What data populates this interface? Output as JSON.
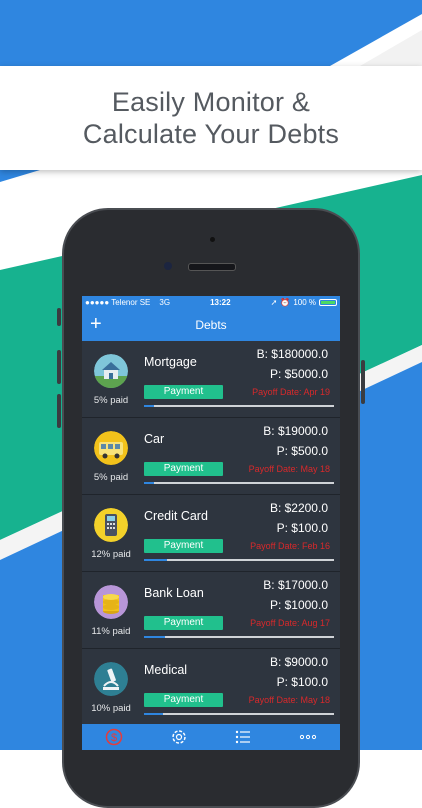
{
  "headline": {
    "line1": "Easily Monitor &",
    "line2": "Calculate Your Debts"
  },
  "status_bar": {
    "carrier": "●●●●● Telenor SE",
    "network": "3G",
    "time": "13:22",
    "battery": "100 %"
  },
  "nav": {
    "title": "Debts",
    "add_icon": "+"
  },
  "debts": [
    {
      "name": "Mortgage",
      "paid": "5% paid",
      "progress": 0.05,
      "balance": "B: $180000.0",
      "payment": "P: $5000.0",
      "payment_button": "Payment",
      "payoff": "Payoff Date: Apr 19",
      "icon": "house-icon"
    },
    {
      "name": "Car",
      "paid": "5% paid",
      "progress": 0.05,
      "balance": "B: $19000.0",
      "payment": "P: $500.0",
      "payment_button": "Payment",
      "payoff": "Payoff Date: May 18",
      "icon": "bus-icon"
    },
    {
      "name": "Credit Card",
      "paid": "12% paid",
      "progress": 0.12,
      "balance": "B: $2200.0",
      "payment": "P: $100.0",
      "payment_button": "Payment",
      "payoff": "Payoff Date: Feb 16",
      "icon": "card-terminal-icon"
    },
    {
      "name": "Bank Loan",
      "paid": "11% paid",
      "progress": 0.11,
      "balance": "B: $17000.0",
      "payment": "P: $1000.0",
      "payment_button": "Payment",
      "payoff": "Payoff Date: Aug 17",
      "icon": "coins-icon"
    },
    {
      "name": "Medical",
      "paid": "10% paid",
      "progress": 0.1,
      "balance": "B: $9000.0",
      "payment": "P: $100.0",
      "payment_button": "Payment",
      "payoff": "Payoff Date: May 18",
      "icon": "microscope-icon"
    }
  ],
  "tabs": [
    "dollar-icon",
    "gear-icon",
    "list-icon",
    "more-icon"
  ],
  "colors": {
    "accent_blue": "#2f86e0",
    "teal": "#17b28f",
    "payment_green": "#21c08d",
    "payoff_red": "#d8292b"
  }
}
